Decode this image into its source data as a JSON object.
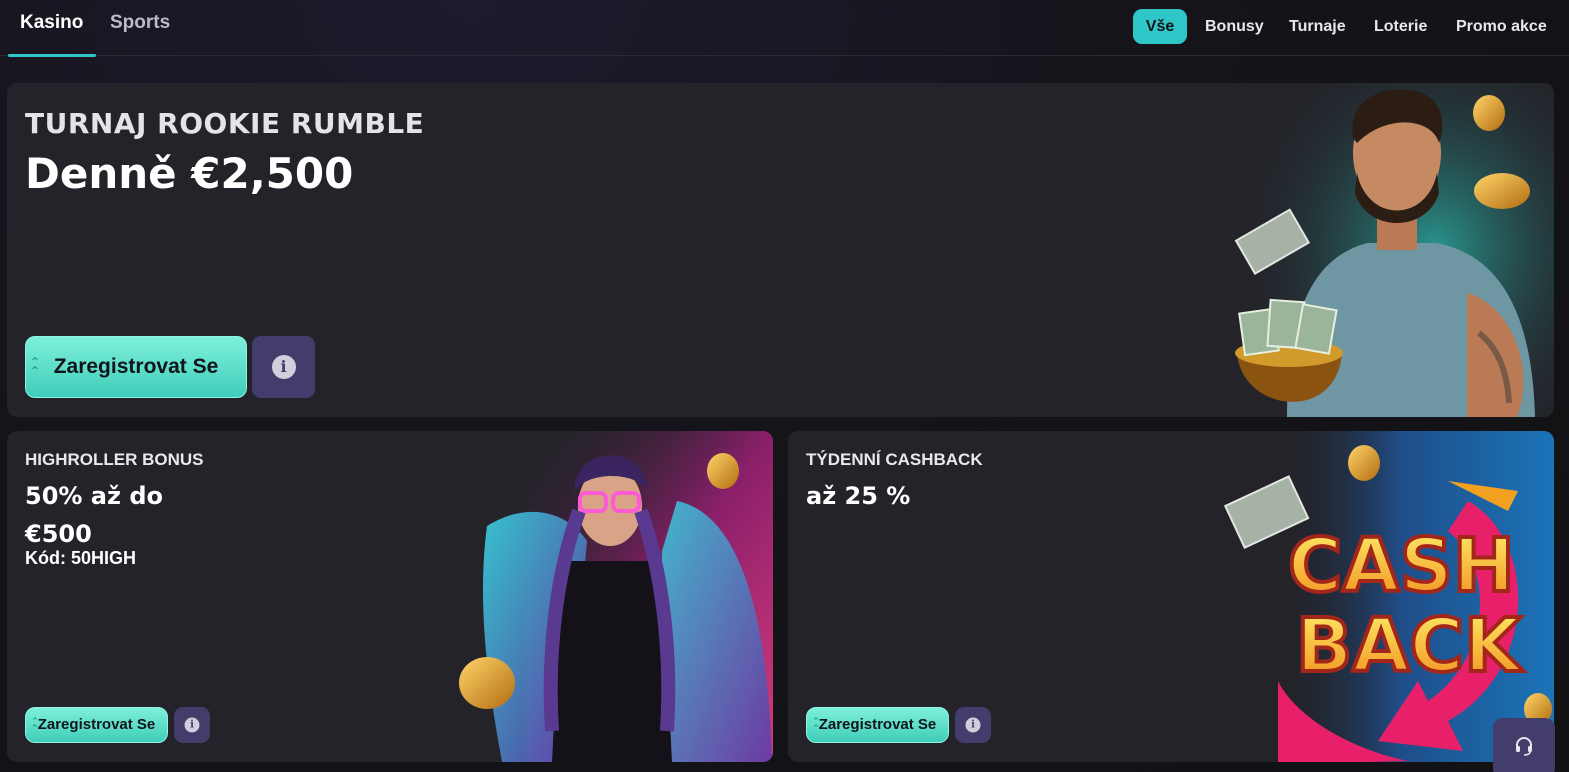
{
  "nav": {
    "main_tabs": [
      {
        "label": "Kasino",
        "active": true
      },
      {
        "label": "Sports",
        "active": false
      }
    ],
    "filters": [
      {
        "label": "Vše",
        "active": true
      },
      {
        "label": "Bonusy",
        "active": false
      },
      {
        "label": "Turnaje",
        "active": false
      },
      {
        "label": "Loterie",
        "active": false
      },
      {
        "label": "Promo akce",
        "active": false
      }
    ]
  },
  "promos": {
    "rookie": {
      "title": "TURNAJ ROOKIE RUMBLE",
      "amount": "Denně €2,500",
      "register_label": "Zaregistrovat Se",
      "info_icon": "info-icon"
    },
    "highroller": {
      "title": "HIGHROLLER BONUS",
      "amount": "50% až do €500",
      "code": "Kód: 50HIGH",
      "register_label": "Zaregistrovat Se",
      "info_icon": "info-icon"
    },
    "cashback": {
      "title": "TÝDENNÍ CASHBACK",
      "amount": "až 25 %",
      "register_label": "Zaregistrovat Se",
      "info_icon": "info-icon",
      "art_text_top": "CASH",
      "art_text_bottom": "BACK"
    }
  },
  "support": {
    "icon": "headset-icon"
  },
  "colors": {
    "accent": "#2fc6c7",
    "button_green": "#5fdcc6",
    "info_purple": "#433d6b",
    "card_bg": "#232329",
    "page_bg": "#141419"
  }
}
